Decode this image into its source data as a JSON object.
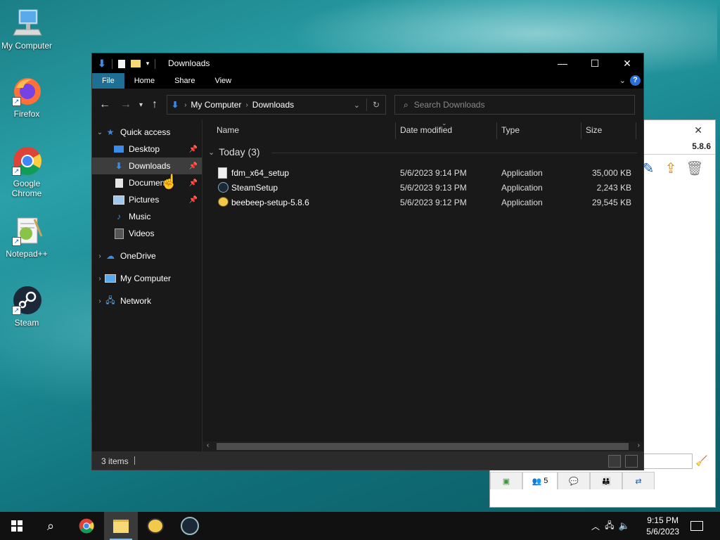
{
  "desktop": {
    "icons": [
      {
        "label": "My Computer",
        "icon": "monitor-icon"
      },
      {
        "label": "Firefox",
        "icon": "firefox-icon"
      },
      {
        "label": "Google Chrome",
        "icon": "chrome-icon"
      },
      {
        "label": "Notepad++",
        "icon": "notepadpp-icon"
      },
      {
        "label": "Steam",
        "icon": "steam-icon"
      }
    ]
  },
  "background_window": {
    "version": "5.8.6",
    "tab_count": "5"
  },
  "explorer": {
    "title": "Downloads",
    "ribbon_tabs": [
      "File",
      "Home",
      "Share",
      "View"
    ],
    "help_label": "?",
    "address": {
      "root": "My Computer",
      "current": "Downloads"
    },
    "search_placeholder": "Search Downloads",
    "nav": {
      "quick_access": "Quick access",
      "desktop": "Desktop",
      "downloads": "Downloads",
      "documents": "Documents",
      "pictures": "Pictures",
      "music": "Music",
      "videos": "Videos",
      "onedrive": "OneDrive",
      "my_computer": "My Computer",
      "network": "Network"
    },
    "columns": {
      "name": "Name",
      "date": "Date modified",
      "type": "Type",
      "size": "Size"
    },
    "group_label": "Today (3)",
    "files": [
      {
        "name": "fdm_x64_setup",
        "date": "5/6/2023 9:14 PM",
        "type": "Application",
        "size": "35,000 KB"
      },
      {
        "name": "SteamSetup",
        "date": "5/6/2023 9:13 PM",
        "type": "Application",
        "size": "2,243 KB"
      },
      {
        "name": "beebeep-setup-5.8.6",
        "date": "5/6/2023 9:12 PM",
        "type": "Application",
        "size": "29,545 KB"
      }
    ],
    "status": "3 items"
  },
  "taskbar": {
    "time": "9:15 PM",
    "date": "5/6/2023"
  },
  "colors": {
    "accent": "#1f6e94",
    "explorer_bg": "#191919",
    "taskbar_bg": "#111111"
  }
}
